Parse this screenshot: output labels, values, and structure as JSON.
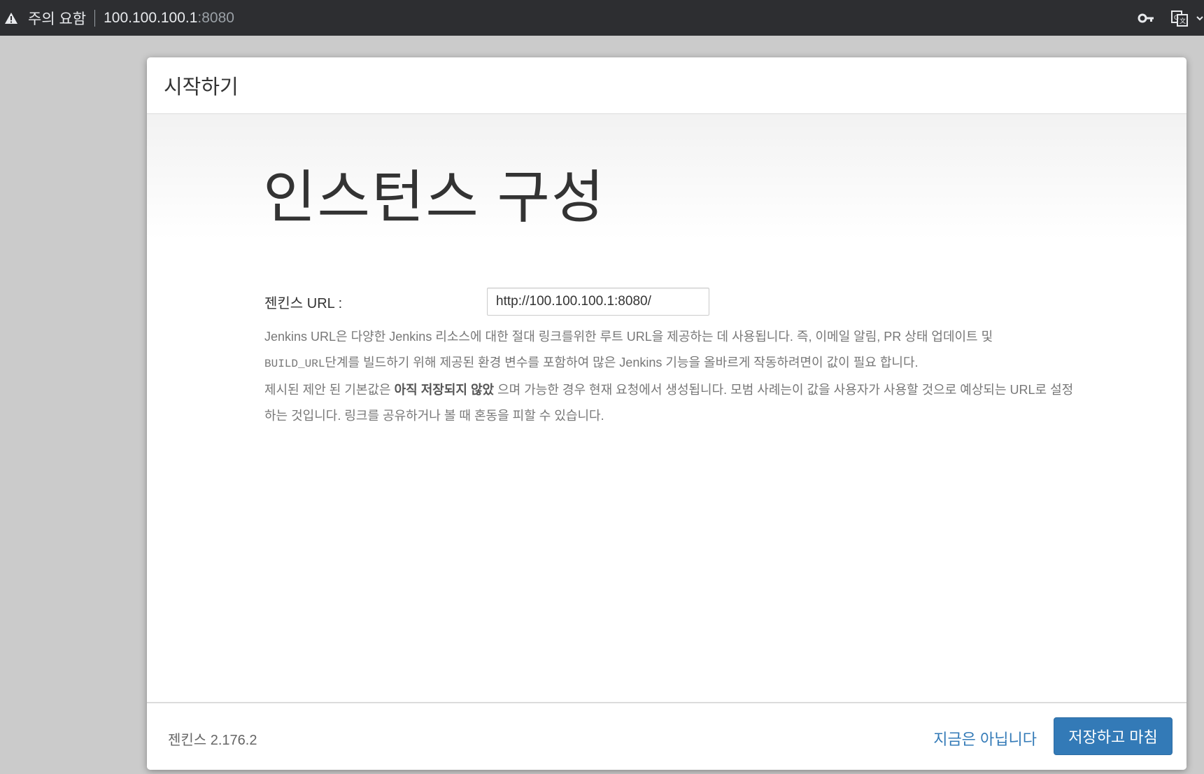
{
  "browser": {
    "warning_text": "주의 요함",
    "url_host": "100.100.100.1",
    "url_port": ":8080"
  },
  "dialog": {
    "header_title": "시작하기",
    "main_title": "인스턴스 구성",
    "url_label": "젠킨스 URL :",
    "url_value": "http://100.100.100.1:8080/",
    "help": {
      "line1": "Jenkins URL은 다양한 Jenkins 리소스에 대한 절대 링크를위한 루트 URL을 제공하는 데 사용됩니다. 즉, 이메일 알림, PR 상태 업데이트 및",
      "build_url": "BUILD_URL",
      "line2_rest": "단계를 빌드하기 위해 제공된 환경 변수를 포함하여 많은 Jenkins 기능을 올바르게 작동하려면이 값이 필요 합니다.",
      "line3_prefix": "제시된 제안 된 기본값은 ",
      "line3_strong": "아직 저장되지 않았",
      "line3_suffix": " 으며 가능한 경우 현재 요청에서 생성됩니다. 모범 사례는이 값을 사용자가 사용할 것으로 예상되는 URL로 설정하는 것입니다. 링크를 공유하거나 볼 때 혼동을 피할 수 있습니다."
    },
    "footer": {
      "version": "젠킨스 2.176.2",
      "not_now_label": "지금은 아닙니다",
      "save_label": "저장하고 마침"
    }
  },
  "colors": {
    "primary": "#337ab7",
    "topbar": "#2d2e31"
  }
}
